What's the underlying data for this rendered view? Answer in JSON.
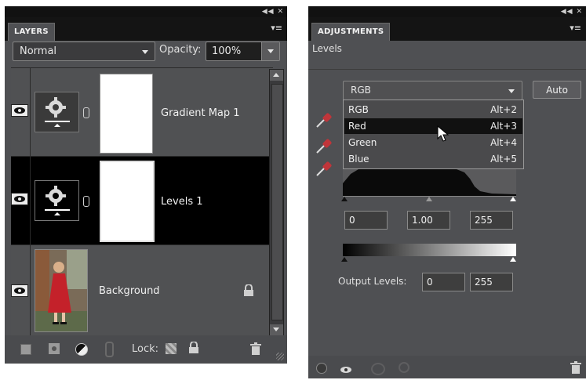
{
  "layers_panel": {
    "tab": "LAYERS",
    "window_controls": "◀◀ ✕",
    "menu_icon": "▾≡",
    "blend_mode": "Normal",
    "opacity_label": "Opacity:",
    "opacity_value": "100%",
    "layers": [
      {
        "name": "Gradient Map 1",
        "selected": false,
        "type": "adjustment"
      },
      {
        "name": "Levels 1",
        "selected": true,
        "type": "adjustment"
      },
      {
        "name": "Background",
        "selected": false,
        "type": "image",
        "locked": true
      }
    ],
    "lock_label": "Lock:"
  },
  "adjustments_panel": {
    "tab": "ADJUSTMENTS",
    "window_controls": "◀◀ ✕",
    "menu_icon": "▾≡",
    "section_title": "Levels",
    "channel_value": "RGB",
    "auto_label": "Auto",
    "channel_menu": [
      {
        "label": "RGB",
        "shortcut": "Alt+2",
        "selected": false
      },
      {
        "label": "Red",
        "shortcut": "Alt+3",
        "selected": true
      },
      {
        "label": "Green",
        "shortcut": "Alt+4",
        "selected": false
      },
      {
        "label": "Blue",
        "shortcut": "Alt+5",
        "selected": false
      }
    ],
    "input_black": "0",
    "input_gamma": "1.00",
    "input_white": "255",
    "output_label": "Output Levels:",
    "output_black": "0",
    "output_white": "255"
  },
  "colors": {
    "panel_bg": "#4f5053",
    "tab_bar": "#141414",
    "selected_row": "#000000",
    "menu_selected": "#111111"
  }
}
